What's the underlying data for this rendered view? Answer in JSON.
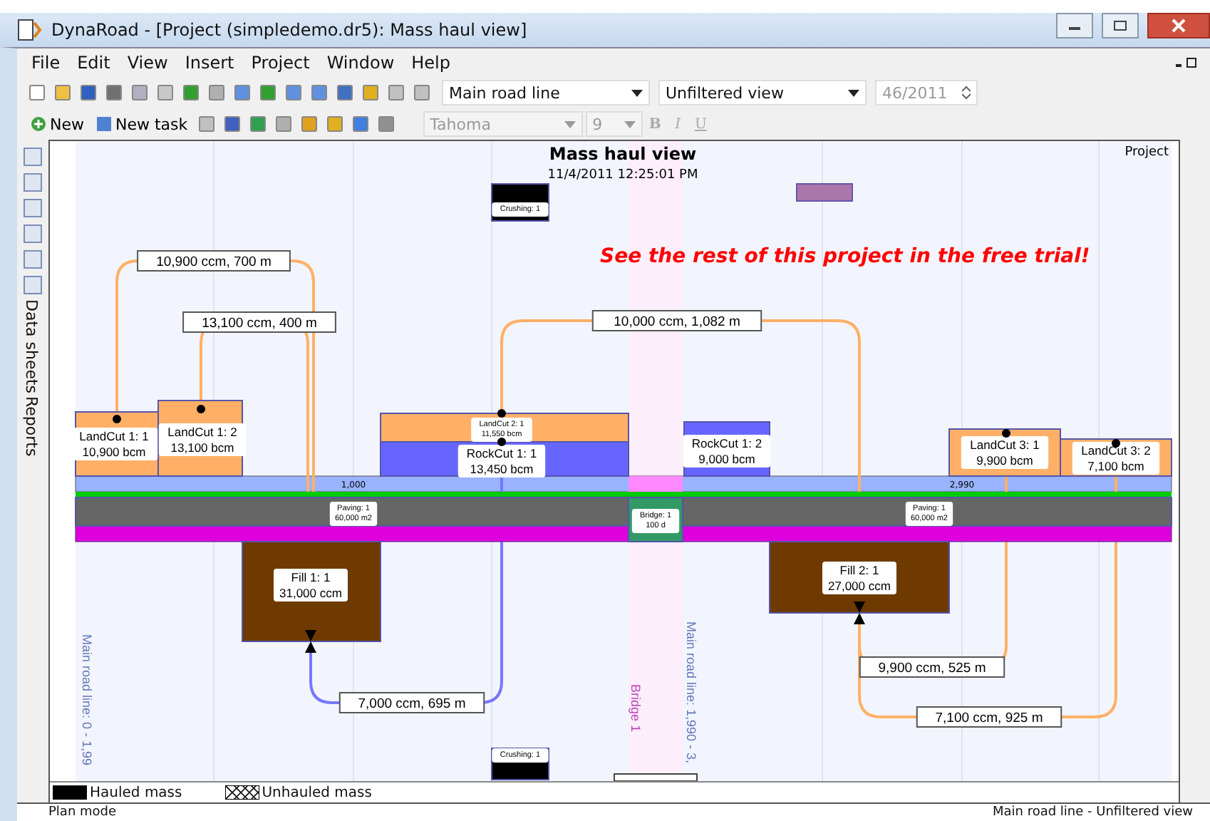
{
  "window": {
    "title": "DynaRoad - [Project (simpledemo.dr5): Mass haul view]"
  },
  "menu": [
    {
      "label": "File"
    },
    {
      "label": "Edit"
    },
    {
      "label": "View"
    },
    {
      "label": "Insert"
    },
    {
      "label": "Project"
    },
    {
      "label": "Window"
    },
    {
      "label": "Help"
    }
  ],
  "toolbar": {
    "road_line": "Main road line",
    "view_filter": "Unfiltered view",
    "week": "46/2011",
    "new_button": "New",
    "new_task_button": "New task",
    "font": "Tahoma",
    "font_size": "9",
    "bold": "B",
    "italic": "I",
    "underline": "U"
  },
  "side_tabs": [
    {
      "label": "Data sheets"
    },
    {
      "label": "Reports"
    }
  ],
  "view": {
    "title": "Mass haul view",
    "timestamp": "11/4/2011 12:25:01 PM",
    "scope": "Project",
    "promo": "See the rest of this project in the free trial!",
    "stations": [
      "1,000",
      "2,990"
    ],
    "vertical_labels": [
      {
        "kind": "section",
        "text": "Main road line: 0 - 1,99"
      },
      {
        "kind": "bridge",
        "text": "Bridge 1"
      },
      {
        "kind": "section",
        "text": "Main road line: 1,990 - 3,"
      }
    ],
    "activities": [
      {
        "kind": "landcut",
        "name": "LandCut 1: 1",
        "amount": "10,900 bcm",
        "small": false
      },
      {
        "kind": "landcut",
        "name": "LandCut 1: 2",
        "amount": "13,100 bcm",
        "small": false
      },
      {
        "kind": "landcut",
        "name": "LandCut 2: 1",
        "amount": "11,550 bcm",
        "small": true
      },
      {
        "kind": "rockcut",
        "name": "RockCut 1: 1",
        "amount": "13,450 bcm",
        "small": false
      },
      {
        "kind": "rockcut",
        "name": "RockCut 1: 2",
        "amount": "9,000 bcm",
        "small": false
      },
      {
        "kind": "landcut",
        "name": "LandCut 3: 1",
        "amount": "9,900 bcm",
        "small": false
      },
      {
        "kind": "landcut",
        "name": "LandCut 3: 2",
        "amount": "7,100 bcm",
        "small": false
      },
      {
        "kind": "fill",
        "name": "Fill 1: 1",
        "amount": "31,000 ccm",
        "small": false
      },
      {
        "kind": "fill",
        "name": "Fill 2: 1",
        "amount": "27,000 ccm",
        "small": false
      },
      {
        "kind": "paving",
        "name": "Paving: 1",
        "amount": "60,000 m2",
        "small": true
      },
      {
        "kind": "paving",
        "name": "Paving: 1",
        "amount": "60,000 m2",
        "small": true
      },
      {
        "kind": "bridge",
        "name": "Bridge: 1",
        "amount": "100 d",
        "small": true
      },
      {
        "kind": "crushing",
        "name": "Crushing: 1",
        "small": true
      },
      {
        "kind": "crushing",
        "name": "Crushing: 1",
        "small": true
      }
    ],
    "hauls": [
      {
        "label": "10,900 ccm, 700 m",
        "color": "#ffb066"
      },
      {
        "label": "13,100 ccm, 400 m",
        "color": "#ffb066"
      },
      {
        "label": "10,000 ccm, 1,082 m",
        "color": "#ffb066"
      },
      {
        "label": "7,000 ccm, 695 m",
        "color": "#7777ff"
      },
      {
        "label": "9,900 ccm, 525 m",
        "color": "#ffb066"
      },
      {
        "label": "7,100 ccm, 925 m",
        "color": "#ffb066"
      }
    ]
  },
  "legend": [
    {
      "kind": "hauled",
      "label": "Hauled mass"
    },
    {
      "kind": "unhauled",
      "label": "Unhauled mass"
    }
  ],
  "status_bar": {
    "mode": "Plan mode",
    "view": "Main road line - Unfiltered view"
  }
}
